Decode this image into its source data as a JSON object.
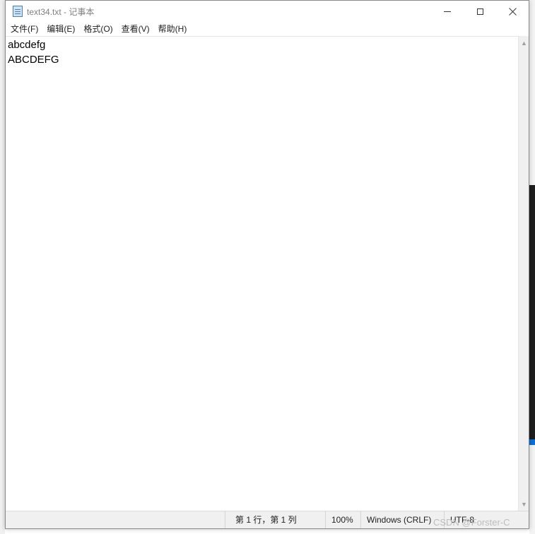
{
  "window": {
    "title": "text34.txt - 记事本",
    "icon": "notepad-icon"
  },
  "caption_buttons": {
    "minimize_icon": "minimize-icon",
    "maximize_icon": "maximize-icon",
    "close_icon": "close-icon"
  },
  "menu": {
    "items": [
      {
        "label": "文件(F)"
      },
      {
        "label": "编辑(E)"
      },
      {
        "label": "格式(O)"
      },
      {
        "label": "查看(V)"
      },
      {
        "label": "帮助(H)"
      }
    ]
  },
  "editor": {
    "lines": [
      "abcdefg",
      "ABCDEFG"
    ]
  },
  "statusbar": {
    "position": "第 1 行，第 1 列",
    "zoom": "100%",
    "line_ending": "Windows (CRLF)",
    "encoding": "UTF-8"
  },
  "watermark": "CSDN @Forster-C"
}
